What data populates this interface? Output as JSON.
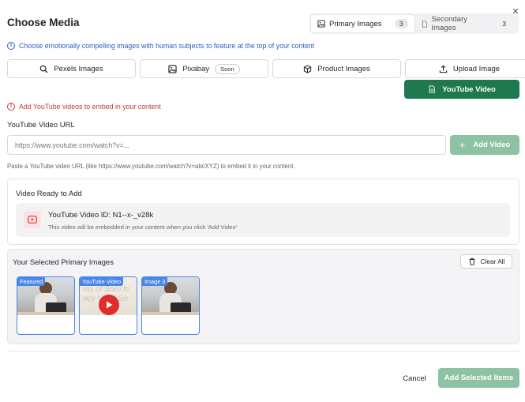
{
  "dialog": {
    "title": "Choose Media",
    "close_icon": "close-icon"
  },
  "tabs": [
    {
      "label": "Primary Images",
      "count": "3",
      "icon": "image-icon",
      "active": true
    },
    {
      "label": "Secondary Images",
      "count": "3",
      "icon": "file-icon",
      "active": false
    }
  ],
  "info_text": "Choose emotionally compelling images with human subjects to feature at the top of your content",
  "sources": [
    {
      "label": "Pexels Images",
      "icon": "search-icon"
    },
    {
      "label": "Pixabay",
      "icon": "image-icon",
      "badge": "Soon"
    },
    {
      "label": "Product Images",
      "icon": "box-icon"
    },
    {
      "label": "Upload Image",
      "icon": "upload-icon"
    }
  ],
  "youtube_button": {
    "label": "YouTube Video",
    "icon": "document-icon"
  },
  "warning_text": "Add YouTube videos to embed in your content",
  "url_field": {
    "label": "YouTube Video URL",
    "placeholder": "https://www.youtube.com/watch?v=...",
    "value": ""
  },
  "add_video_button": {
    "label": "Add Video",
    "icon": "plus-icon"
  },
  "hint": "Paste a YouTube video URL (like https://www.youtube.com/watch?v=abcXYZ) to embed it in your content.",
  "video_ready": {
    "heading": "Video Ready to Add",
    "video_id": "YouTube Video ID: N1--x-_v28k",
    "subtext": "This video will be embedded in your content when you click 'Add Video'"
  },
  "selected": {
    "heading": "Your Selected Primary Images",
    "clear_label": "Clear All",
    "items": [
      {
        "badge": "Featured",
        "kind": "image"
      },
      {
        "badge": "YouTube Video",
        "kind": "video"
      },
      {
        "badge": "Image 3",
        "kind": "image"
      }
    ]
  },
  "footer": {
    "cancel": "Cancel",
    "add_selected": "Add Selected Items"
  },
  "colors": {
    "primary_green": "#1e7a4e",
    "disabled_green": "#8dc3a4",
    "info_blue": "#2d5fc4",
    "warning_red": "#c23a3a",
    "selection_blue": "#4a86e8"
  }
}
